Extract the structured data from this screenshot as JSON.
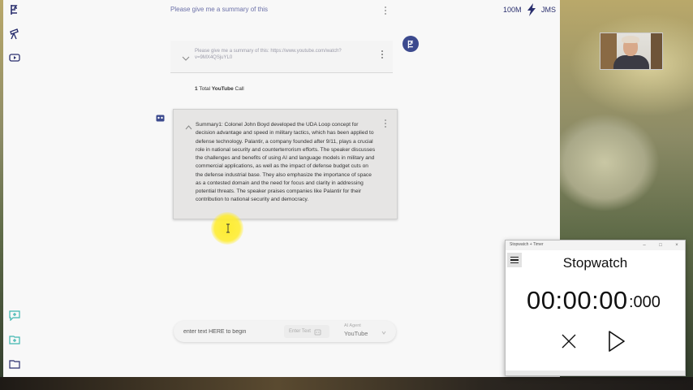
{
  "app": {
    "title": "Please give me a summary of this",
    "credits": "100M",
    "user_initials": "JMS"
  },
  "prompt": {
    "text": "Please give me a summary of this: https://www.youtube.com/watch?v=9MX4QSjuYL0"
  },
  "calls": {
    "count": "1",
    "label_pre": "Total",
    "service": "YouTube",
    "label_post": "Call"
  },
  "summary": {
    "text": "Summary1: Colonel John Boyd developed the UDA Loop concept for decision advantage and speed in military tactics, which has been applied to defense technology. Palantir, a company founded after 9/11, plays a crucial role in national security and counterterrorism efforts. The speaker discusses the challenges and benefits of using AI and language models in military and commercial applications, as well as the impact of defense budget cuts on the defense industrial base. They also emphasize the importance of space as a contested domain and the need for focus and clarity in addressing potential threats. The speaker praises companies like Palantir for their contribution to national security and democracy."
  },
  "input": {
    "placeholder": "enter text HERE to begin",
    "enter_button": "Enter Text",
    "agent_label": "AI Agent",
    "agent_value": "YouTube"
  },
  "stopwatch": {
    "window_title": "Stopwatch + Timer",
    "heading": "Stopwatch",
    "time": "00:00:00",
    "ms": ":000"
  },
  "colors": {
    "accent": "#2a2f6e",
    "avatar": "#3c4a8e",
    "highlight": "#ffec28"
  },
  "icons": [
    "logo-icon",
    "telescope-icon",
    "video-icon",
    "chat-plus-icon",
    "folder-plus-icon",
    "folder-icon",
    "bolt-icon",
    "kebab-icon",
    "chevron-down-icon",
    "chevron-up-icon",
    "robot-icon",
    "menu-icon",
    "reset-icon",
    "play-icon"
  ]
}
